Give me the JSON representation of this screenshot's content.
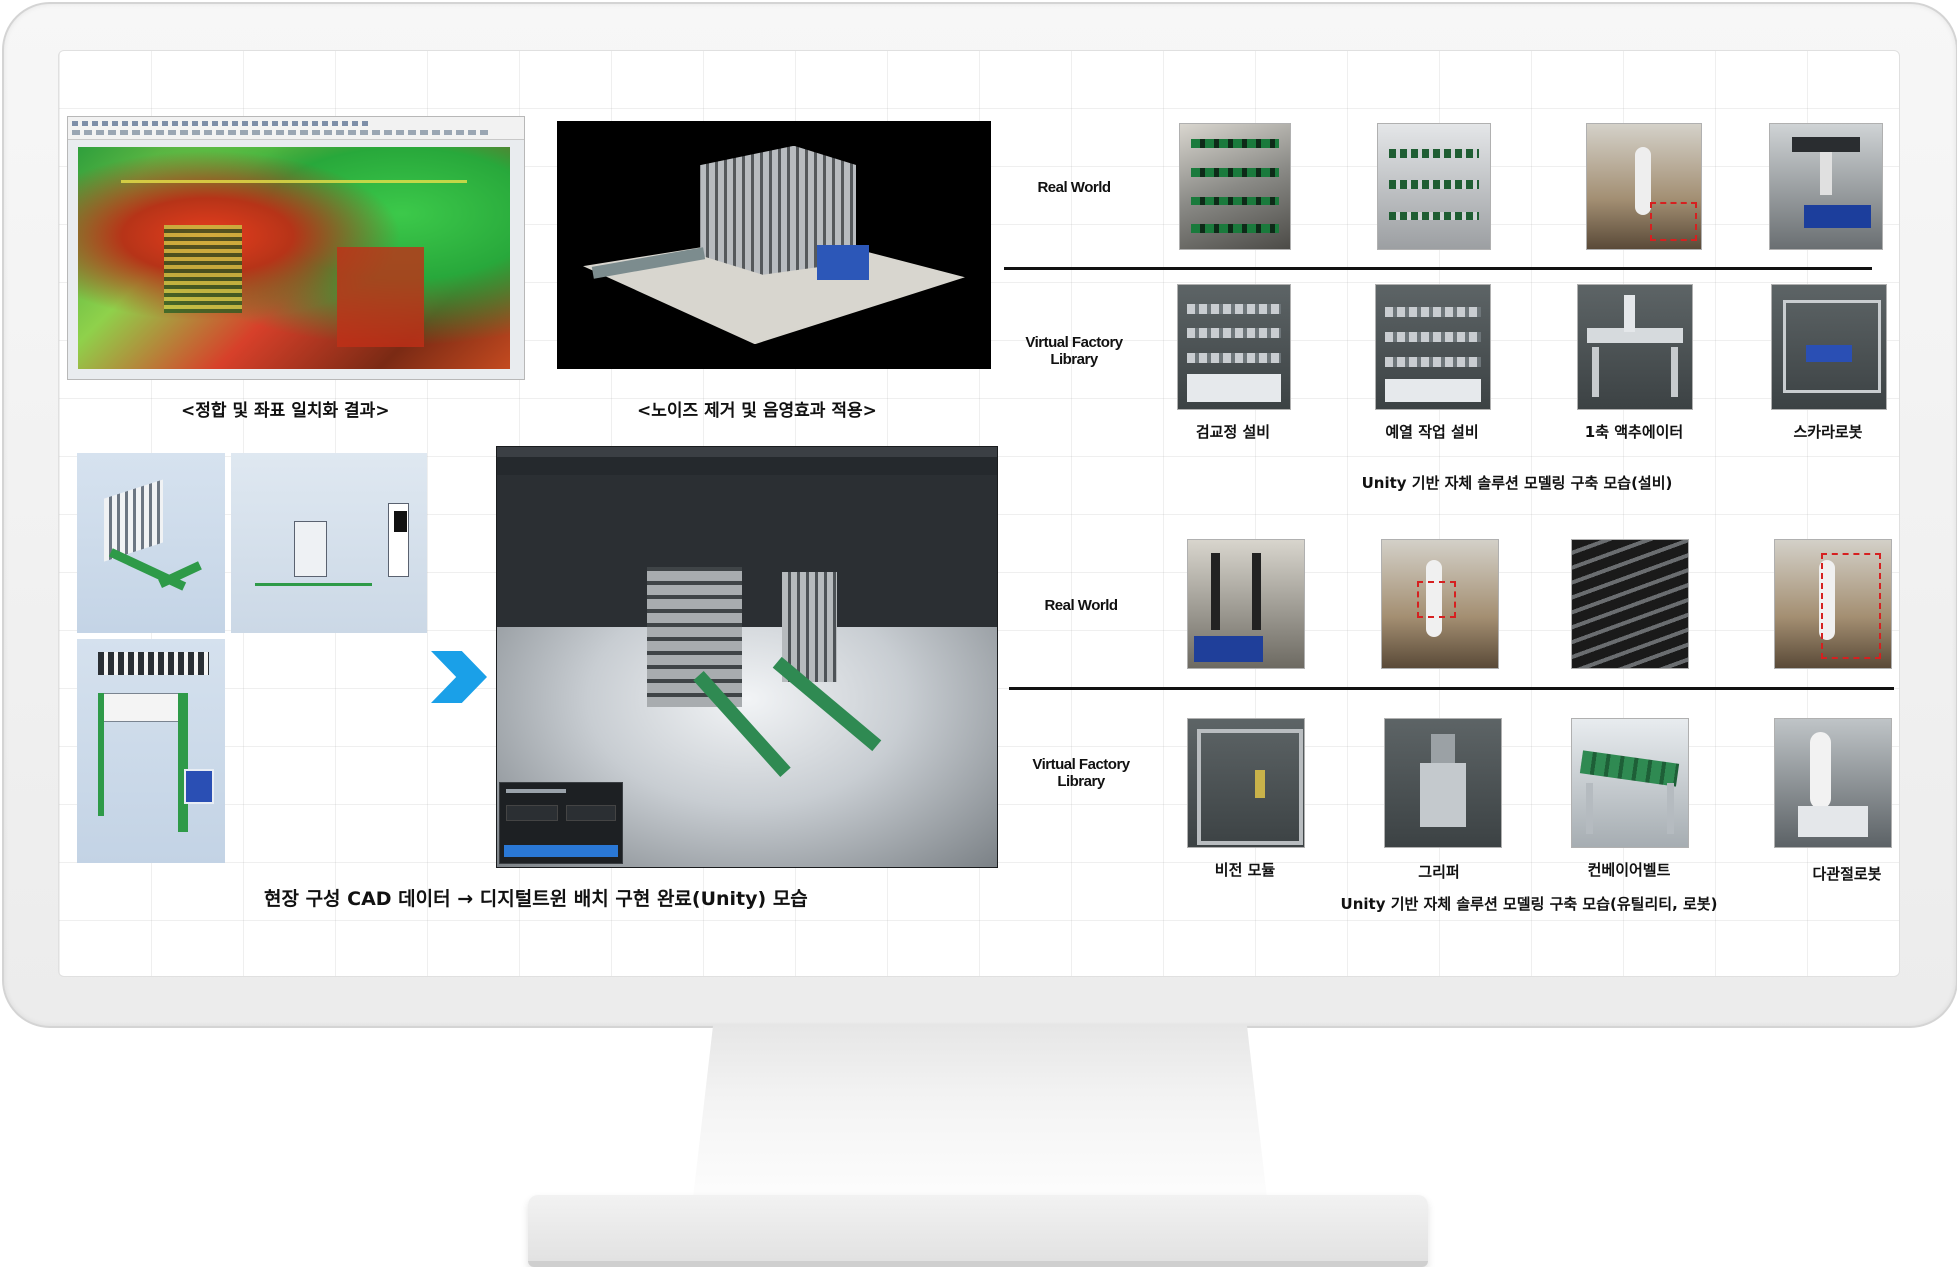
{
  "captions": {
    "scan_result": "<정합 및 좌표 일치화 결과>",
    "noise_removal": "<노이즈 제거 및 음영효과 적용>",
    "cad_to_unity": "현장 구성 CAD 데이터 → 디지털트윈 배치 구현 완료(Unity) 모습"
  },
  "facility_section": {
    "real_world_label": "Real World",
    "library_label": "Virtual Factory Library",
    "items": [
      "검교정 설비",
      "예열 작업 설비",
      "1축 액추에이터",
      "스카라로봇"
    ],
    "caption": "Unity 기반 자체 솔루션 모델링 구축 모습(설비)"
  },
  "utility_section": {
    "real_world_label": "Real World",
    "library_label": "Virtual Factory Library",
    "items": [
      "비전 모듈",
      "그리퍼",
      "컨베이어벨트",
      "다관절로봇"
    ],
    "caption": "Unity 기반 자체 솔루션 모델링 구축 모습(유틸리티, 로봇)"
  },
  "colors": {
    "arrow": "#1aa0e8",
    "scan_green": "#3cc94a",
    "scan_red": "#d23a1c",
    "unity_dark": "#2b2f33",
    "unity_button": "#2a78d6"
  },
  "icons": [
    "chevron-right-icon"
  ]
}
